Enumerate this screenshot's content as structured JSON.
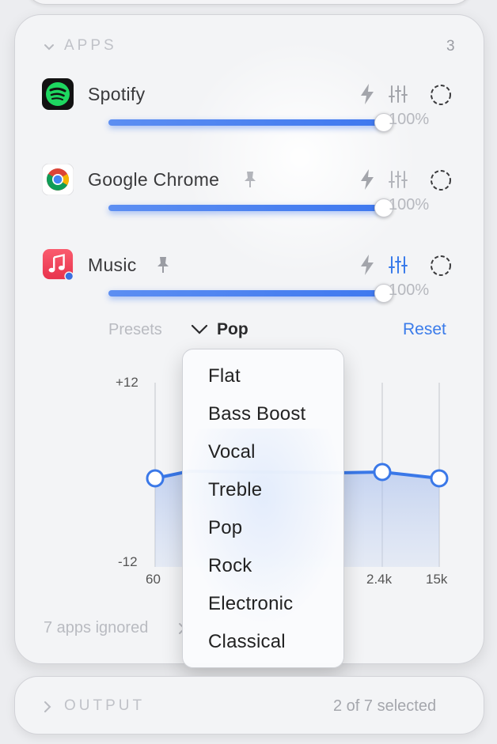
{
  "apps_section": {
    "title": "APPS",
    "count": "3",
    "items": [
      {
        "name": "Spotify",
        "volume_label": "100%",
        "volume": 1.0,
        "pinned": false,
        "eq_active": false
      },
      {
        "name": "Google Chrome",
        "volume_label": "100%",
        "volume": 1.0,
        "pinned": true,
        "eq_active": false
      },
      {
        "name": "Music",
        "volume_label": "100%",
        "volume": 1.0,
        "pinned": true,
        "eq_active": true
      }
    ]
  },
  "equalizer": {
    "presets_label": "Presets",
    "selected_preset": "Pop",
    "reset_label": "Reset",
    "y_max_label": "+12",
    "y_min_label": "-12",
    "x_labels": [
      "60",
      "2.4k",
      "15k"
    ]
  },
  "preset_menu": {
    "options": [
      "Flat",
      "Bass Boost",
      "Vocal",
      "Treble",
      "Pop",
      "Rock",
      "Electronic",
      "Classical"
    ]
  },
  "footer": {
    "ignored_text": "7 apps ignored"
  },
  "output_section": {
    "title": "OUTPUT",
    "selected_text": "2 of 7 selected"
  },
  "colors": {
    "accent": "#3a7bea",
    "slider": "#4a82f0",
    "spotify_green": "#1ed760",
    "music_red": "#f24a5e"
  }
}
